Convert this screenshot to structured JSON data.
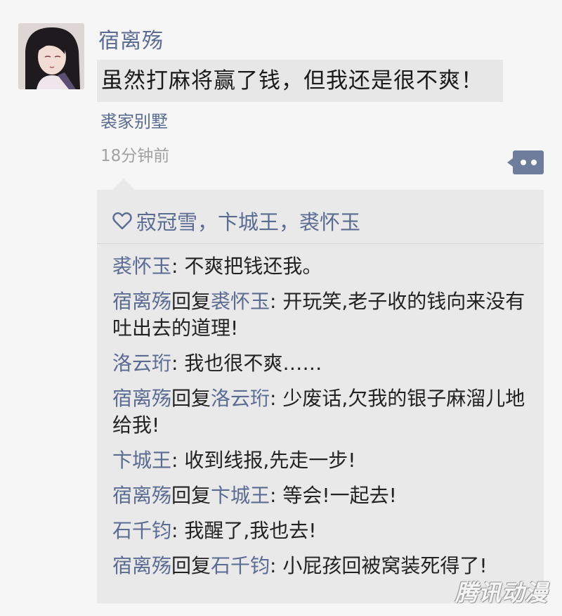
{
  "post": {
    "author": "宿离殇",
    "text": "虽然打麻将赢了钱，但我还是很不爽！",
    "location": "裘家别墅",
    "timestamp": "18分钟前"
  },
  "likes": {
    "icon": "heart-outline-icon",
    "names": "寂冠雪，卞城王，裘怀玉"
  },
  "comments": [
    {
      "author": "裘怀玉",
      "reply_word": "",
      "reply_to": "",
      "separator": ": ",
      "text": "不爽把钱还我。"
    },
    {
      "author": "宿离殇",
      "reply_word": "回复",
      "reply_to": "裘怀玉",
      "separator": ": ",
      "text": "开玩笑,老子收的钱向来没有吐出去的道理!"
    },
    {
      "author": "洛云珩",
      "reply_word": "",
      "reply_to": "",
      "separator": ": ",
      "text": "我也很不爽……"
    },
    {
      "author": "宿离殇",
      "reply_word": "回复",
      "reply_to": "洛云珩",
      "separator": ": ",
      "text": "少废话,欠我的银子麻溜儿地给我!"
    },
    {
      "author": "卞城王",
      "reply_word": "",
      "reply_to": "",
      "separator": ": ",
      "text": "收到线报,先走一步!"
    },
    {
      "author": "宿离殇",
      "reply_word": "回复",
      "reply_to": "卞城王",
      "separator": ": ",
      "text": "等会!一起去!"
    },
    {
      "author": "石千钧",
      "reply_word": "",
      "reply_to": "",
      "separator": ": ",
      "text": "我醒了,我也去!"
    },
    {
      "author": "宿离殇",
      "reply_word": "回复",
      "reply_to": "石千钧",
      "separator": ": ",
      "text": "小屁孩回被窝装死得了!"
    }
  ],
  "more_button_icon": "more-dots-icon",
  "watermark": "腾讯动漫",
  "colors": {
    "name_blue": "#5b6b92",
    "bubble_gray": "#e7e7e7",
    "comment_bg": "#e9e9e9",
    "button_bg": "#6e7d9c"
  }
}
